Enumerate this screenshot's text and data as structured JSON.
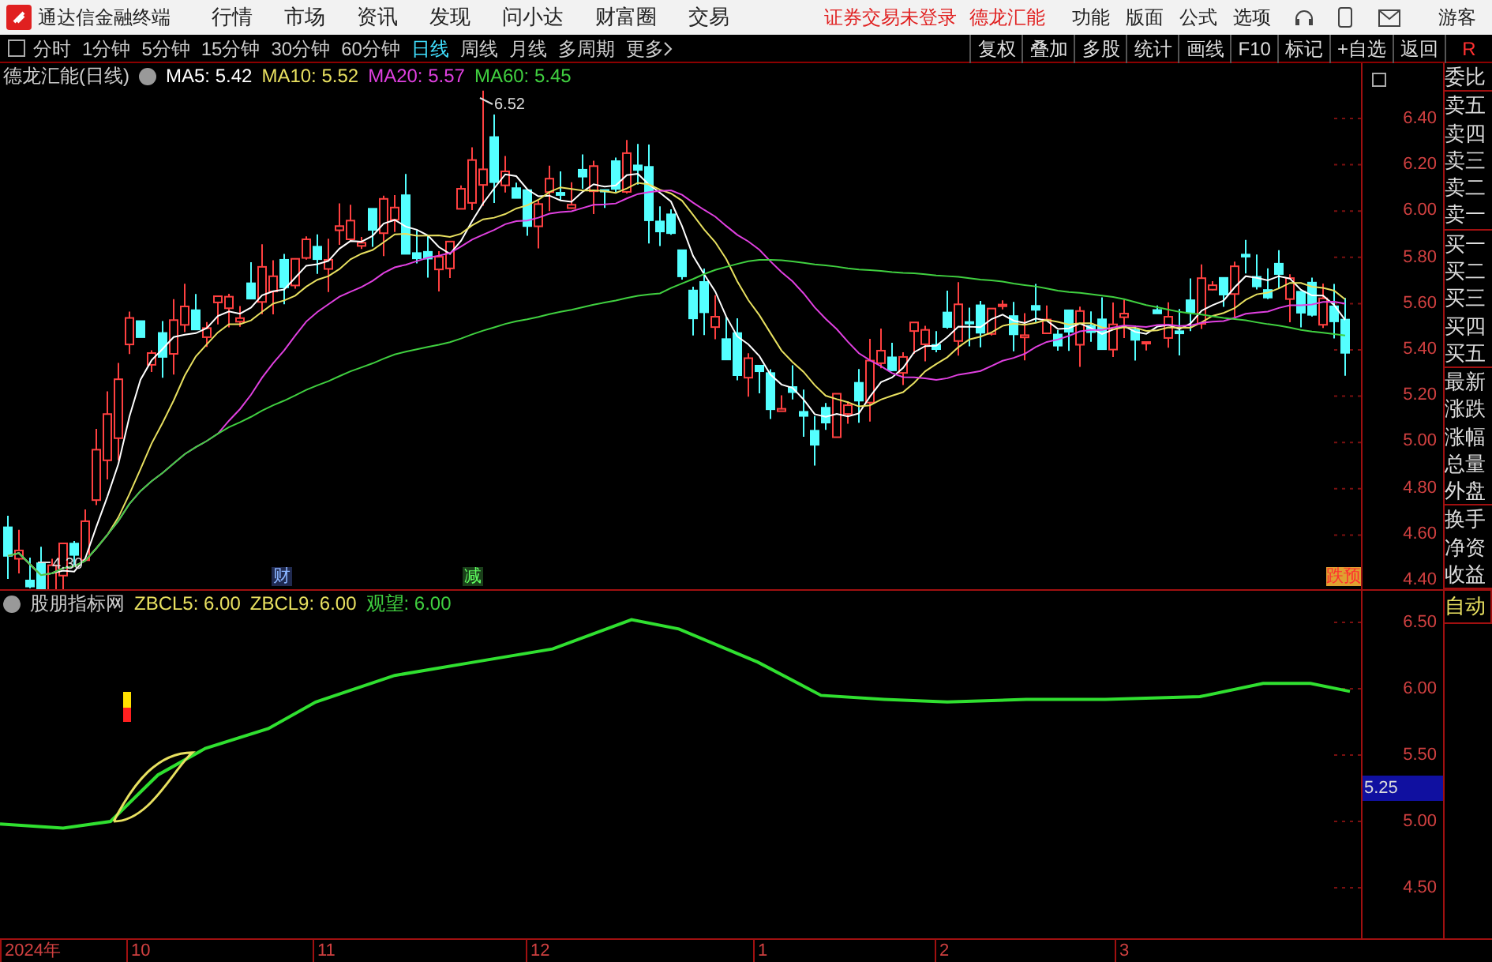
{
  "app": {
    "title": "通达信金融终端"
  },
  "menu": [
    "行情",
    "市场",
    "资讯",
    "发现",
    "问小达",
    "财富圈",
    "交易"
  ],
  "login_notice": "证券交易未登录",
  "stock_link": "德龙汇能",
  "top_right": [
    "功能",
    "版面",
    "公式",
    "选项"
  ],
  "guest": "游客",
  "periods": [
    {
      "label": "分时",
      "selected": false
    },
    {
      "label": "1分钟",
      "selected": false
    },
    {
      "label": "5分钟",
      "selected": false
    },
    {
      "label": "15分钟",
      "selected": false
    },
    {
      "label": "30分钟",
      "selected": false
    },
    {
      "label": "60分钟",
      "selected": false
    },
    {
      "label": "日线",
      "selected": true
    },
    {
      "label": "周线",
      "selected": false
    },
    {
      "label": "月线",
      "selected": false
    },
    {
      "label": "多周期",
      "selected": false
    }
  ],
  "more": "更多",
  "toolbar_buttons": [
    "复权",
    "叠加",
    "多股",
    "统计",
    "画线",
    "F10",
    "标记",
    "+自选",
    "返回"
  ],
  "mode_badge": "R",
  "price_panel": {
    "title": "德龙汇能(日线)",
    "ma": [
      {
        "label": "MA5: 5.42",
        "color": "#ffffff"
      },
      {
        "label": "MA10: 5.52",
        "color": "#e8e060"
      },
      {
        "label": "MA20: 5.57",
        "color": "#e040e0"
      },
      {
        "label": "MA60: 5.45",
        "color": "#40d040"
      }
    ],
    "high_label": "6.52",
    "low_label": "4.30",
    "yaxis": [
      "6.40",
      "6.20",
      "6.00",
      "5.80",
      "5.60",
      "5.40",
      "5.20",
      "5.00",
      "4.80",
      "4.60",
      "4.40"
    ],
    "markers": [
      "财",
      "减"
    ],
    "edge_marker": "跌预"
  },
  "sidebar": {
    "groups": [
      [
        "委比"
      ],
      [
        "卖五",
        "卖四",
        "卖三",
        "卖二",
        "卖一"
      ],
      [
        "买一",
        "买二",
        "买三",
        "买四",
        "买五"
      ],
      [
        "最新",
        "涨跌",
        "涨幅",
        "总量",
        "外盘"
      ],
      [
        "换手",
        "净资",
        "收益"
      ]
    ]
  },
  "indicator_panel": {
    "title": "股朋指标网",
    "values": [
      {
        "label": "ZBCL5: 6.00",
        "color": "#e8e060"
      },
      {
        "label": "ZBCL9: 6.00",
        "color": "#e8e060"
      },
      {
        "label": "观望: 6.00",
        "color": "#40d040"
      }
    ],
    "yaxis": [
      "6.50",
      "6.00",
      "5.50",
      "5.00",
      "4.50"
    ],
    "current": "5.25",
    "mode": "自动"
  },
  "date_axis": [
    "2024年",
    "10",
    "11",
    "12",
    "1",
    "2",
    "3"
  ]
}
